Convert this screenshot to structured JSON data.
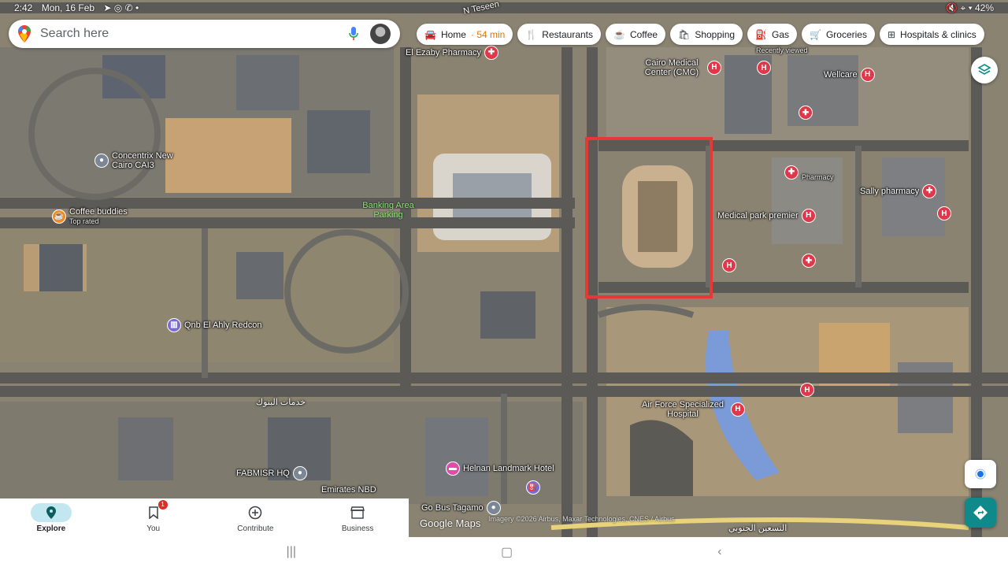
{
  "status_bar": {
    "time": "2:42",
    "date": "Mon, 16 Feb",
    "battery": "42%"
  },
  "search": {
    "placeholder": "Search here"
  },
  "chips": [
    {
      "icon": "car-icon",
      "label": "Home",
      "eta": "54 min"
    },
    {
      "icon": "restaurant-icon",
      "label": "Restaurants"
    },
    {
      "icon": "coffee-icon",
      "label": "Coffee"
    },
    {
      "icon": "shopping-icon",
      "label": "Shopping"
    },
    {
      "icon": "gas-icon",
      "label": "Gas"
    },
    {
      "icon": "cart-icon",
      "label": "Groceries"
    },
    {
      "icon": "hospital-icon",
      "label": "Hospitals & clinics"
    }
  ],
  "map": {
    "streets": [
      "N Teseen",
      "خدمات البنوك",
      "التسعين الجنوبي"
    ],
    "pois": {
      "el_ezaby": "El Ezaby Pharmacy",
      "cairo_medical": "Cairo Medical Center (CMC)",
      "recently_viewed": "Recently viewed",
      "wellcare": "Wellcare",
      "concentrix": "Concentrix New Cairo CAI3",
      "coffee_buddies": "Coffee buddies",
      "coffee_buddies_sub": "Top rated",
      "banking_area": "Banking Area Parking",
      "pharmacy_ar": "Pharmacy",
      "sally": "Sally pharmacy",
      "medical_park": "Medical park premier",
      "qnb": "Qnb El Ahly Redcon",
      "air_force": "Air Force Specialized Hospital",
      "fabmisr": "FABMISR HQ",
      "helnan": "Helnan Landmark Hotel",
      "emirates": "Emirates NBD",
      "go_bus": "Go Bus Tagamo"
    },
    "highlight_color": "#e53935"
  },
  "bottom_nav": {
    "items": [
      {
        "label": "Explore",
        "icon": "location-pin-icon",
        "active": true
      },
      {
        "label": "You",
        "icon": "bookmark-icon",
        "badge": "1"
      },
      {
        "label": "Contribute",
        "icon": "add-circle-icon"
      },
      {
        "label": "Business",
        "icon": "storefront-icon"
      }
    ]
  },
  "attribution": "Google Maps",
  "copyright": "Imagery ©2026 Airbus, Maxar Technologies, CNES / Airbus"
}
